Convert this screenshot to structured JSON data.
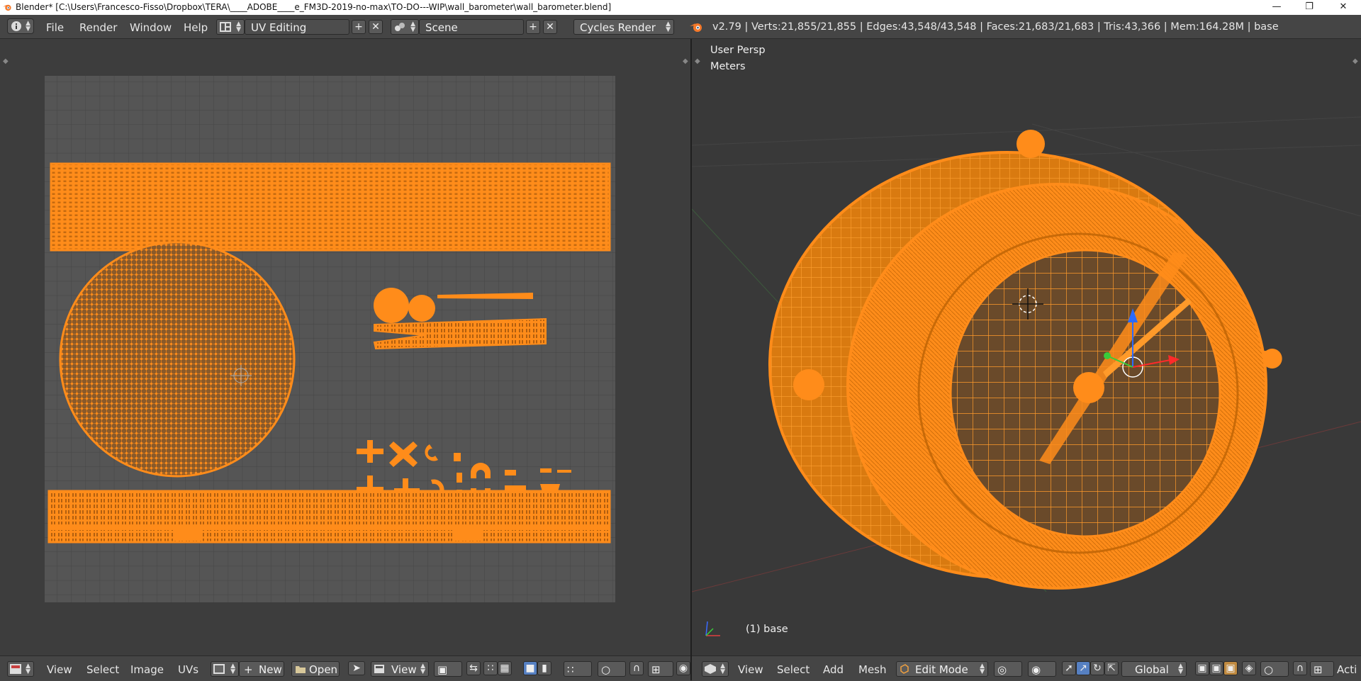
{
  "titlebar": {
    "title": "Blender* [C:\\Users\\Francesco-Fisso\\Dropbox\\TERA\\____ADOBE____e_FM3D-2019-no-max\\TO-DO---WIP\\wall_barometer\\wall_barometer.blend]",
    "minimize": "—",
    "maximize": "❐",
    "close": "✕"
  },
  "topbar": {
    "menus": [
      "File",
      "Render",
      "Window",
      "Help"
    ],
    "screen_layout": "UV Editing",
    "scene": "Scene",
    "render_engine": "Cycles Render",
    "stats": "v2.79 | Verts:21,855/21,855 | Edges:43,548/43,548 | Faces:21,683/21,683 | Tris:43,366 | Mem:164.28M | base"
  },
  "viewport": {
    "view_name": "User Persp",
    "units": "Meters",
    "object_label": "(1) base"
  },
  "uv_header": {
    "menus": [
      "View",
      "Select",
      "Image",
      "UVs"
    ],
    "new_label": "New",
    "open_label": "Open",
    "view_dropdown": "View"
  },
  "view3d_header": {
    "menus": [
      "View",
      "Select",
      "Add",
      "Mesh"
    ],
    "mode": "Edit Mode",
    "orientation": "Global",
    "active_label": "Acti"
  },
  "colors": {
    "mesh": "#ff8c1a",
    "mesh_dark": "#e07000",
    "grid_bg": "#505050",
    "panel": "#454545",
    "viewport_bg": "#393939"
  }
}
